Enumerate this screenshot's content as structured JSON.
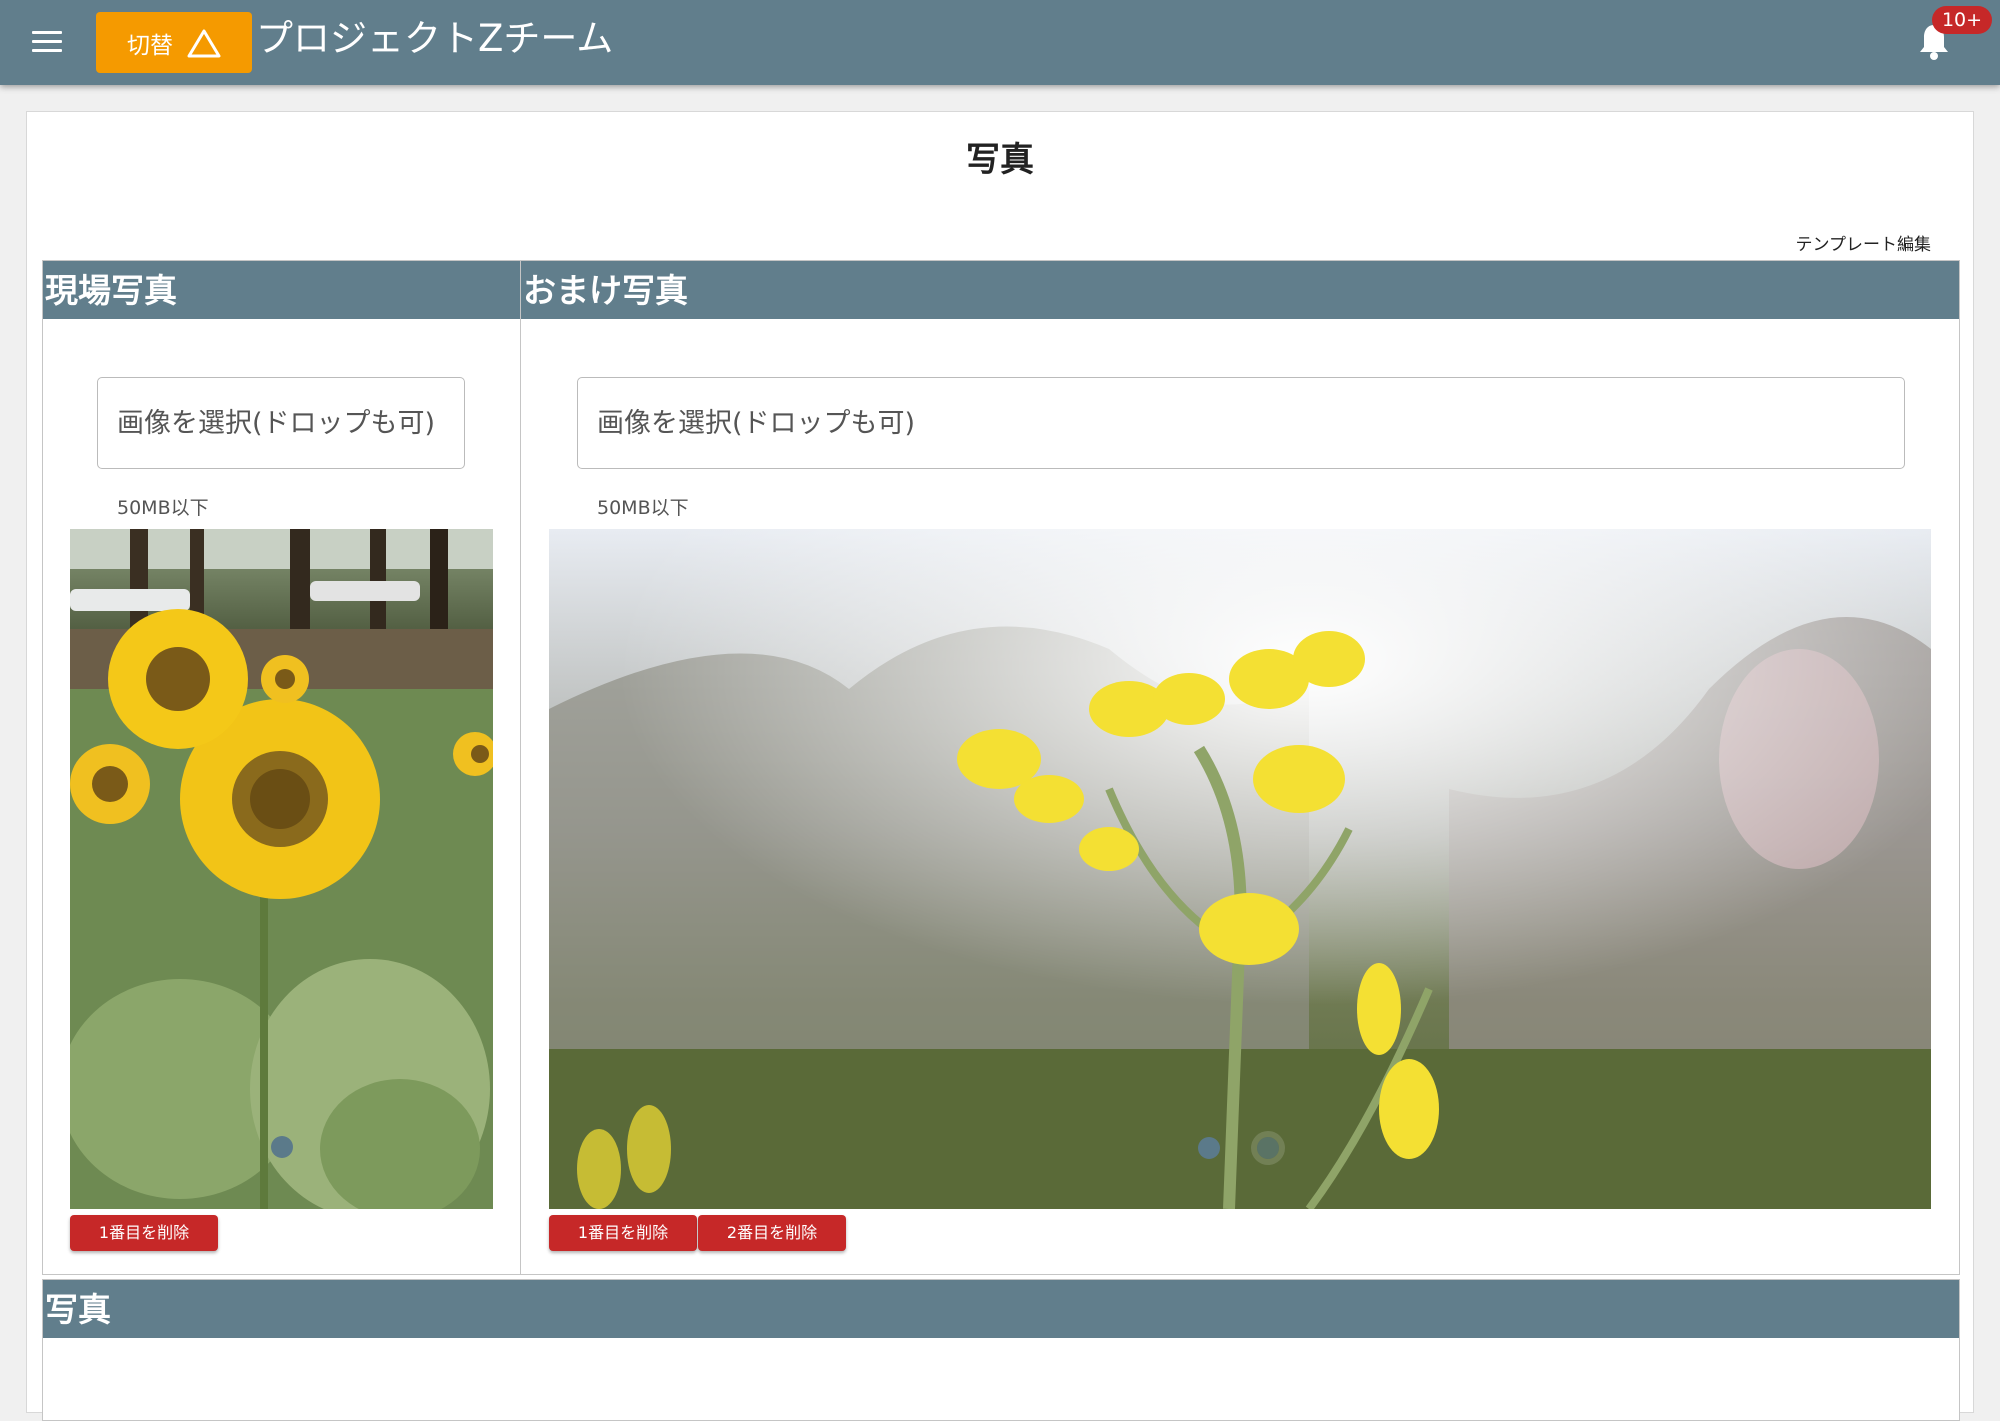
{
  "appbar": {
    "switch_label": "切替",
    "title": "プロジェクトZチーム",
    "notification_badge": "10+"
  },
  "page": {
    "title": "写真",
    "template_edit_label": "テンプレート編集"
  },
  "panels": [
    {
      "header": "現場写真",
      "file_input_placeholder": "画像を選択(ドロップも可)",
      "size_note": "50MB以下",
      "delete_buttons": [
        "1番目を削除"
      ]
    },
    {
      "header": "おまけ写真",
      "file_input_placeholder": "画像を選択(ドロップも可)",
      "size_note": "50MB以下",
      "delete_buttons": [
        "1番目を削除",
        "2番目を削除"
      ]
    }
  ],
  "bottom_section": {
    "header": "写真"
  },
  "colors": {
    "appbar": "#617e8c",
    "switch_button": "#f59a00",
    "delete_button": "#c62828",
    "badge": "#c62828"
  }
}
